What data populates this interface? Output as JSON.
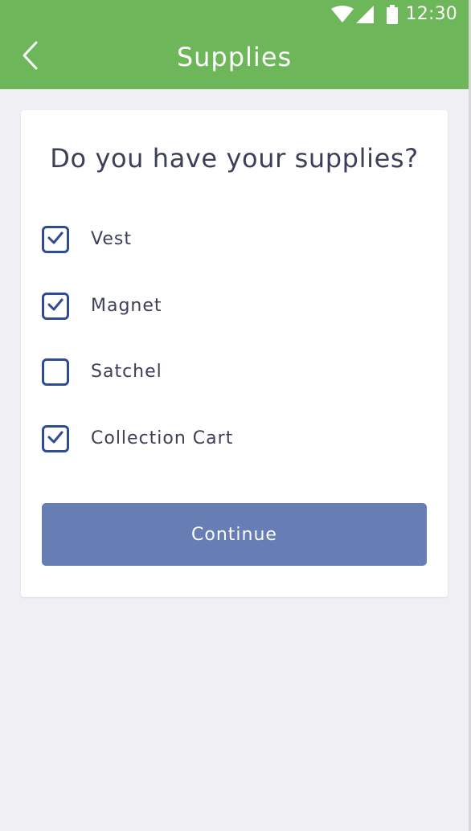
{
  "status_bar": {
    "time": "12:30",
    "icons": [
      "wifi-icon",
      "signal-icon",
      "battery-icon"
    ]
  },
  "header": {
    "back_icon": "chevron-left-icon",
    "title": "Supplies"
  },
  "card": {
    "question": "Do you have your supplies?",
    "options": [
      {
        "label": "Vest",
        "checked": true
      },
      {
        "label": "Magnet",
        "checked": true
      },
      {
        "label": "Satchel",
        "checked": false
      },
      {
        "label": "Collection Cart",
        "checked": true
      }
    ],
    "continue_label": "Continue"
  },
  "colors": {
    "header_background": "#6db659",
    "page_background": "#efeff4",
    "card_background": "#ffffff",
    "text": "#3c3f58",
    "checkbox_accent": "#2e4c94",
    "button_background": "#667eb4",
    "button_text": "#ffffff"
  }
}
